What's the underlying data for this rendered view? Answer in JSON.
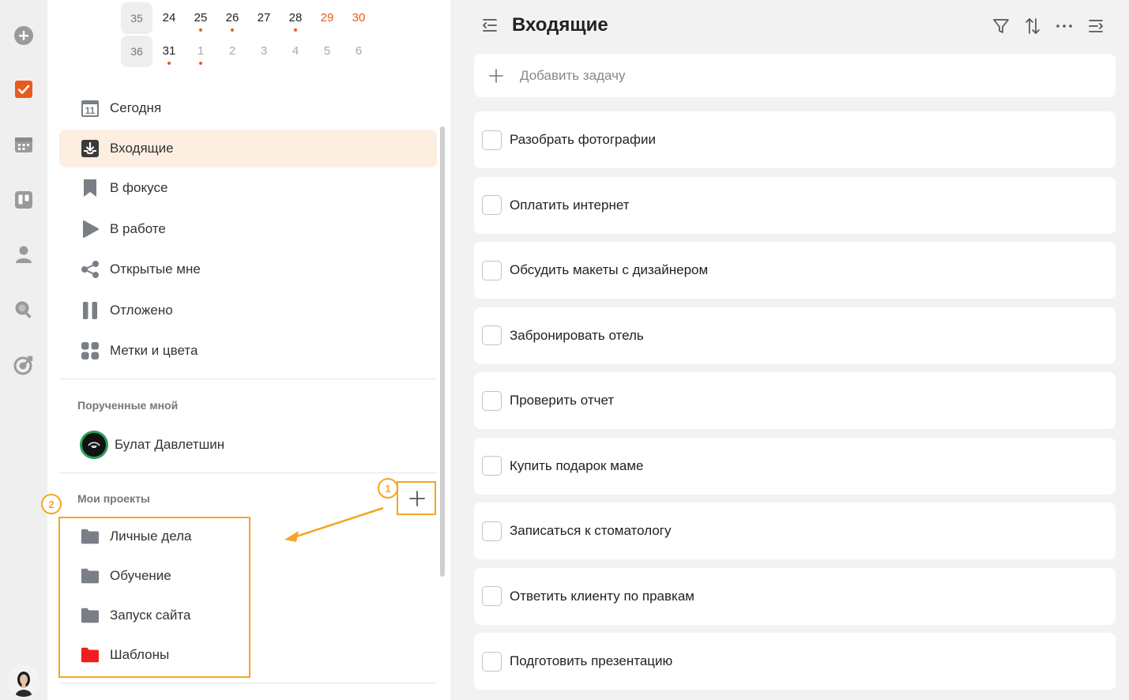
{
  "calendar": {
    "weeks": [
      {
        "week": "35",
        "days": [
          {
            "d": "24",
            "kind": "normal",
            "dot": false
          },
          {
            "d": "25",
            "kind": "normal",
            "dot": true
          },
          {
            "d": "26",
            "kind": "normal",
            "dot": true
          },
          {
            "d": "27",
            "kind": "normal",
            "dot": false
          },
          {
            "d": "28",
            "kind": "normal",
            "dot": true
          },
          {
            "d": "29",
            "kind": "weekend",
            "dot": false
          },
          {
            "d": "30",
            "kind": "weekend",
            "dot": false
          }
        ]
      },
      {
        "week": "36",
        "days": [
          {
            "d": "31",
            "kind": "normal",
            "dot": true
          },
          {
            "d": "1",
            "kind": "muted",
            "dot": true
          },
          {
            "d": "2",
            "kind": "muted",
            "dot": false
          },
          {
            "d": "3",
            "kind": "muted",
            "dot": false
          },
          {
            "d": "4",
            "kind": "muted",
            "dot": false
          },
          {
            "d": "5",
            "kind": "muted",
            "dot": false
          },
          {
            "d": "6",
            "kind": "muted",
            "dot": false
          }
        ]
      }
    ]
  },
  "nav": {
    "today_badge": "11",
    "items": [
      {
        "label": "Сегодня",
        "icon": "calendar-today-icon",
        "active": false
      },
      {
        "label": "Входящие",
        "icon": "inbox-icon",
        "active": true
      },
      {
        "label": "В фокусе",
        "icon": "bookmark-icon",
        "active": false
      },
      {
        "label": "В работе",
        "icon": "play-icon",
        "active": false
      },
      {
        "label": "Открытые мне",
        "icon": "share-icon",
        "active": false
      },
      {
        "label": "Отложено",
        "icon": "pause-icon",
        "active": false
      },
      {
        "label": "Метки и цвета",
        "icon": "tags-icon",
        "active": false
      }
    ]
  },
  "assigned": {
    "title": "Порученные мной",
    "user": "Булат Давлетшин"
  },
  "projects": {
    "title": "Мои проекты",
    "items": [
      {
        "label": "Личные дела",
        "icon": "folder-icon",
        "color": "#7a7f87"
      },
      {
        "label": "Обучение",
        "icon": "folder-icon",
        "color": "#7a7f87"
      },
      {
        "label": "Запуск сайта",
        "icon": "folder-icon",
        "color": "#7a7f87"
      },
      {
        "label": "Шаблоны",
        "icon": "folder-icon",
        "color": "#f21d1d"
      }
    ]
  },
  "annotations": {
    "badge1": "1",
    "badge2": "2"
  },
  "header": {
    "title": "Входящие"
  },
  "add_task": {
    "placeholder": "Добавить задачу"
  },
  "tasks": [
    "Разобрать фотографии",
    "Оплатить интернет",
    "Обсудить макеты с дизайнером",
    "Забронировать отель",
    "Проверить отчет",
    "Купить подарок маме",
    "Записаться к стоматологу",
    "Ответить клиенту по правкам",
    "Подготовить презентацию"
  ],
  "colors": {
    "accent": "#ea5a1e",
    "annotation": "#f5a623",
    "active_bg": "#fdeee2",
    "rail_icon": "#9a9a9a"
  }
}
